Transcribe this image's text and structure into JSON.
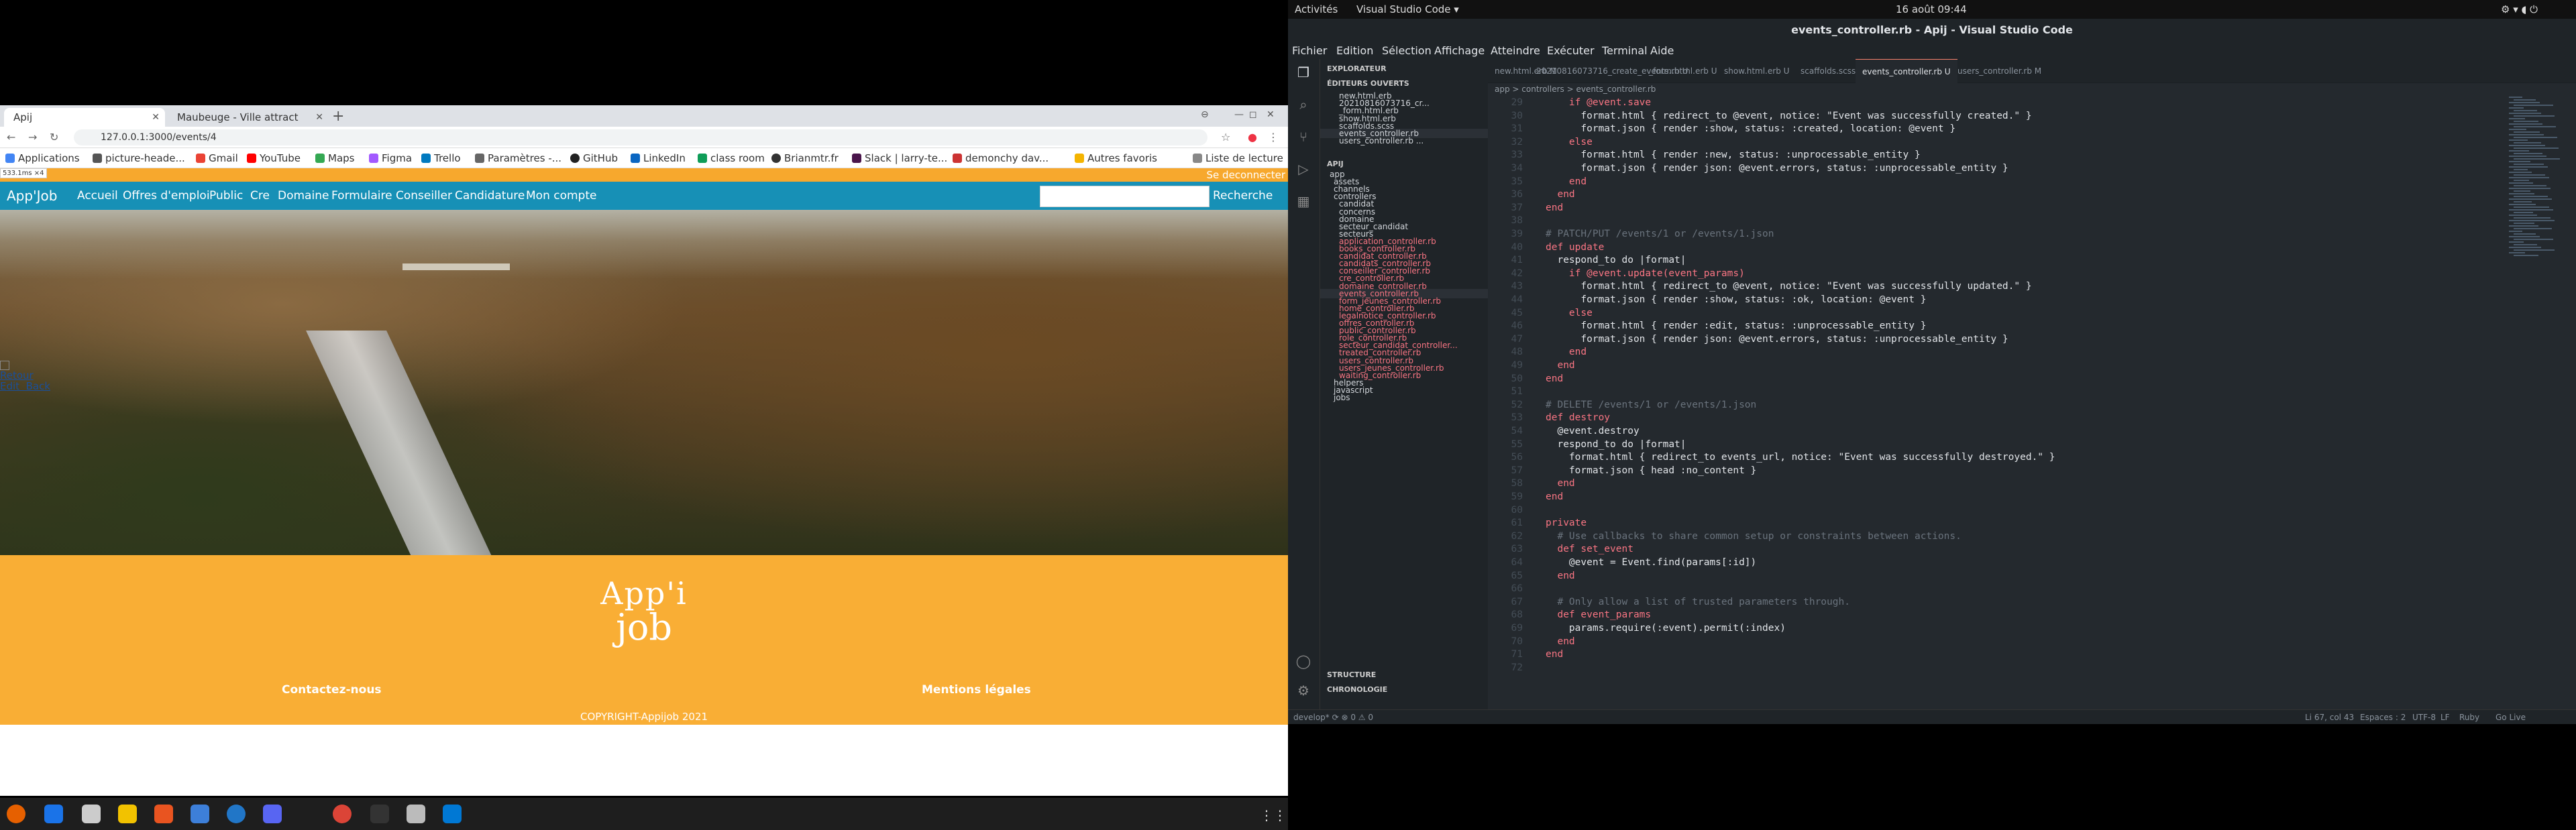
{
  "browser": {
    "tabs": [
      {
        "title": "Apij",
        "active": true
      },
      {
        "title": "Maubeuge - Ville attract",
        "active": false
      }
    ],
    "url": "127.0.0.1:3000/events/4",
    "bookmarks": [
      "Applications",
      "picture-heade...",
      "Gmail",
      "YouTube",
      "Maps",
      "Figma",
      "Trello",
      "Paramètres -...",
      "GitHub",
      "LinkedIn",
      "class room",
      "Brianmtr.fr",
      "Slack | larry-te...",
      "demonchy dav..."
    ],
    "other_bookmarks": "Autres favoris",
    "reading_list": "Liste de lecture"
  },
  "site": {
    "logout": "Se deconnecter",
    "dev_badge": "533.1ms ×4",
    "brand": "App'Job",
    "nav": [
      "Accueil",
      "Offres d'emploi",
      "Public",
      "Cre",
      "Domaine",
      "Formulaire",
      "Conseiller",
      "Candidature",
      "Mon compte"
    ],
    "search_button": "Recherche",
    "broken_image_text": "Retour\nEdit  Back",
    "footer_logo_line1": "App'i",
    "footer_logo_line2": "job",
    "contact": "Contactez-nous",
    "legal": "Mentions légales",
    "copyright": "COPYRIGHT-Appijob 2021"
  },
  "gnome": {
    "activities": "Activités",
    "app": "Visual Studio Code ▾",
    "clock": "16 août  09:44"
  },
  "vscode": {
    "title": "events_controller.rb - Apij - Visual Studio Code",
    "menu": [
      "Fichier",
      "Edition",
      "Sélection",
      "Affichage",
      "Atteindre",
      "Exécuter",
      "Terminal",
      "Aide"
    ],
    "explorer_title": "EXPLORATEUR",
    "open_editors_title": "ÉDITEURS OUVERTS",
    "open_editors": [
      "new.html.erb",
      "20210816073716_cr...",
      "_form.html.erb",
      "show.html.erb",
      "scaffolds.scss",
      "events_controller.rb",
      "users_controller.rb ..."
    ],
    "project": "APIJ",
    "tree": [
      "app",
      "assets",
      "channels",
      "controllers",
      "candidat",
      "concerns",
      "domaine",
      "secteur_candidat",
      "secteurs",
      "application_controller.rb",
      "books_controller.rb",
      "candidat_controller.rb",
      "candidats_controller.rb",
      "conseiller_controller.rb",
      "cre_controller.rb",
      "domaine_controller.rb",
      "events_controller.rb",
      "form_jeunes_controller.rb",
      "home_controller.rb",
      "legalnotice_controller.rb",
      "offres_controller.rb",
      "public_controller.rb",
      "role_controller.rb",
      "secteur_candidat_controller...",
      "treated_controller.rb",
      "users_controller.rb",
      "users_jeunes_controller.rb",
      "waiting_controller.rb",
      "helpers",
      "javascript",
      "jobs"
    ],
    "outline": "STRUCTURE",
    "timeline": "CHRONOLOGIE",
    "tabs": [
      "new.html.erb M",
      "20210816073716_create_events.rb U",
      "_form.html.erb U",
      "show.html.erb U",
      "scaffolds.scss",
      "events_controller.rb U",
      "users_controller.rb M"
    ],
    "breadcrumb": "app  >  controllers  >  events_controller.rb",
    "code": [
      {
        "n": "29",
        "t": "    if @event.save"
      },
      {
        "n": "30",
        "t": "      format.html { redirect_to @event, notice: \"Event was successfully created.\" }"
      },
      {
        "n": "31",
        "t": "      format.json { render :show, status: :created, location: @event }"
      },
      {
        "n": "32",
        "t": "    else"
      },
      {
        "n": "33",
        "t": "      format.html { render :new, status: :unprocessable_entity }"
      },
      {
        "n": "34",
        "t": "      format.json { render json: @event.errors, status: :unprocessable_entity }"
      },
      {
        "n": "35",
        "t": "    end"
      },
      {
        "n": "36",
        "t": "  end"
      },
      {
        "n": "37",
        "t": "end"
      },
      {
        "n": "38",
        "t": ""
      },
      {
        "n": "39",
        "t": "# PATCH/PUT /events/1 or /events/1.json"
      },
      {
        "n": "40",
        "t": "def update"
      },
      {
        "n": "41",
        "t": "  respond_to do |format|"
      },
      {
        "n": "42",
        "t": "    if @event.update(event_params)"
      },
      {
        "n": "43",
        "t": "      format.html { redirect_to @event, notice: \"Event was successfully updated.\" }"
      },
      {
        "n": "44",
        "t": "      format.json { render :show, status: :ok, location: @event }"
      },
      {
        "n": "45",
        "t": "    else"
      },
      {
        "n": "46",
        "t": "      format.html { render :edit, status: :unprocessable_entity }"
      },
      {
        "n": "47",
        "t": "      format.json { render json: @event.errors, status: :unprocessable_entity }"
      },
      {
        "n": "48",
        "t": "    end"
      },
      {
        "n": "49",
        "t": "  end"
      },
      {
        "n": "50",
        "t": "end"
      },
      {
        "n": "51",
        "t": ""
      },
      {
        "n": "52",
        "t": "# DELETE /events/1 or /events/1.json"
      },
      {
        "n": "53",
        "t": "def destroy"
      },
      {
        "n": "54",
        "t": "  @event.destroy"
      },
      {
        "n": "55",
        "t": "  respond_to do |format|"
      },
      {
        "n": "56",
        "t": "    format.html { redirect_to events_url, notice: \"Event was successfully destroyed.\" }"
      },
      {
        "n": "57",
        "t": "    format.json { head :no_content }"
      },
      {
        "n": "58",
        "t": "  end"
      },
      {
        "n": "59",
        "t": "end"
      },
      {
        "n": "60",
        "t": ""
      },
      {
        "n": "61",
        "t": "private"
      },
      {
        "n": "62",
        "t": "  # Use callbacks to share common setup or constraints between actions."
      },
      {
        "n": "63",
        "t": "  def set_event"
      },
      {
        "n": "64",
        "t": "    @event = Event.find(params[:id])"
      },
      {
        "n": "65",
        "t": "  end"
      },
      {
        "n": "66",
        "t": ""
      },
      {
        "n": "67",
        "t": "  # Only allow a list of trusted parameters through."
      },
      {
        "n": "68",
        "t": "  def event_params"
      },
      {
        "n": "69",
        "t": "    params.require(:event).permit(:index)"
      },
      {
        "n": "70",
        "t": "  end"
      },
      {
        "n": "71",
        "t": "end"
      },
      {
        "n": "72",
        "t": ""
      }
    ],
    "status_left": "develop*  ⟳  ⊗ 0 ⚠ 0",
    "status_right": [
      "Li 67, col 43",
      "Espaces : 2",
      "UTF-8",
      "LF",
      "Ruby",
      "Go Live"
    ]
  },
  "colors": {
    "site_nav": "#1790b6",
    "site_footer": "#f9ae35",
    "vscode_bg": "#24292e"
  }
}
